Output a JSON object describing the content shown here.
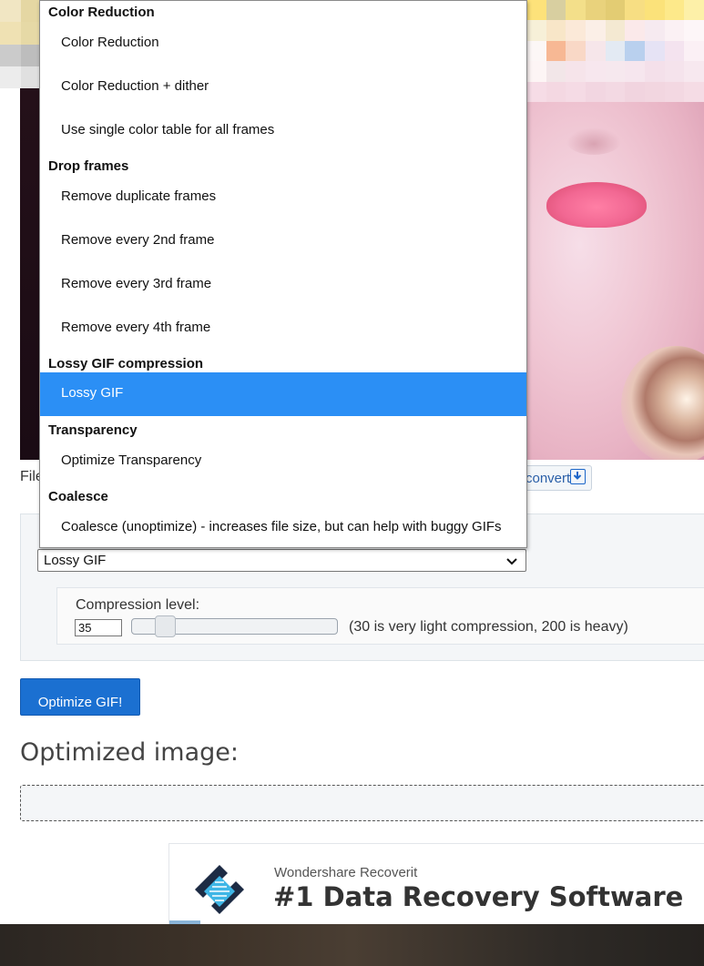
{
  "file_label": "File",
  "convert_label": "convert",
  "dropdown": {
    "groups": [
      {
        "label": "Color Reduction",
        "options": [
          "Color Reduction",
          "Color Reduction + dither",
          "Use single color table for all frames"
        ]
      },
      {
        "label": "Drop frames",
        "options": [
          "Remove duplicate frames",
          "Remove every 2nd frame",
          "Remove every 3rd frame",
          "Remove every 4th frame"
        ]
      },
      {
        "label": "Lossy GIF compression",
        "options": [
          "Lossy GIF"
        ]
      },
      {
        "label": "Transparency",
        "options": [
          "Optimize Transparency"
        ]
      },
      {
        "label": "Coalesce",
        "options": [
          "Coalesce (unoptimize) - increases file size, but can help with buggy GIFs"
        ]
      }
    ],
    "selected": "Lossy GIF"
  },
  "method_select": {
    "value": "Lossy GIF"
  },
  "compression": {
    "label": "Compression level:",
    "value": "35",
    "hint": "(30 is very light compression, 200 is heavy)"
  },
  "optimize_button": "Optimize GIF!",
  "optimized_heading": "Optimized image:",
  "ad": {
    "brand": "Wondershare Recoverit",
    "headline": "#1 Data Recovery Software"
  },
  "colors": {
    "accent": "#1b70d1",
    "selected_option": "#2b8ff5"
  }
}
